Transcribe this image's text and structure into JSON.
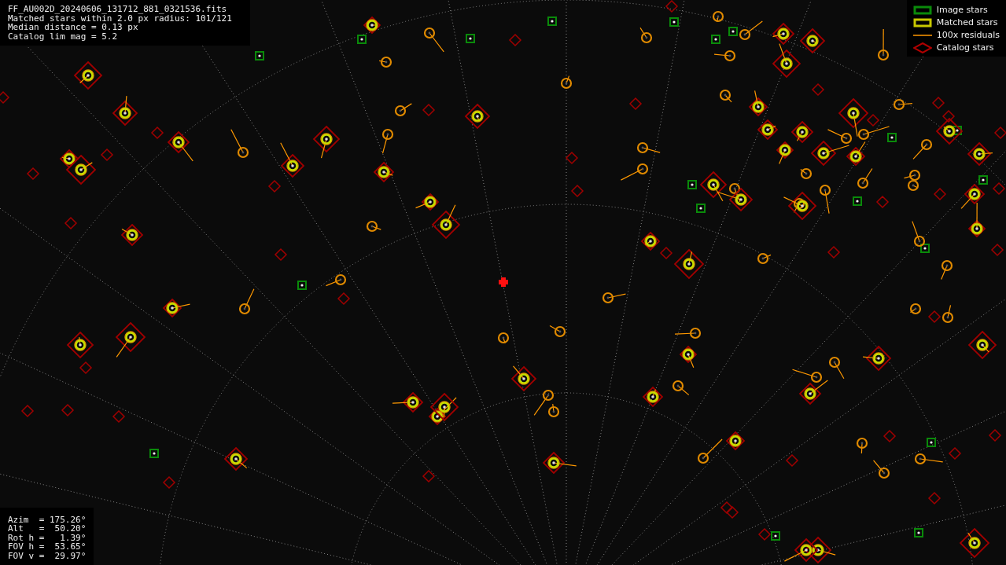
{
  "info_text": [
    "FF_AU002D_20240606_131712_881_0321536.fits",
    "Matched stars within 2.0 px radius: 101/121",
    "Median distance = 0.13 px",
    "Catalog lim mag = 5.2"
  ],
  "pointing_text": [
    "Azim  = 175.26°",
    "Alt   =  50.20°",
    "Rot h =   1.39°",
    "FOV h =  53.65°",
    "FOV v =  29.97°"
  ],
  "legend": [
    {
      "kind": "image",
      "label": "Image stars"
    },
    {
      "kind": "matched",
      "label": "Matched stars"
    },
    {
      "kind": "residual",
      "label": "100x residuals"
    },
    {
      "kind": "catalog",
      "label": "Catalog stars"
    }
  ]
}
